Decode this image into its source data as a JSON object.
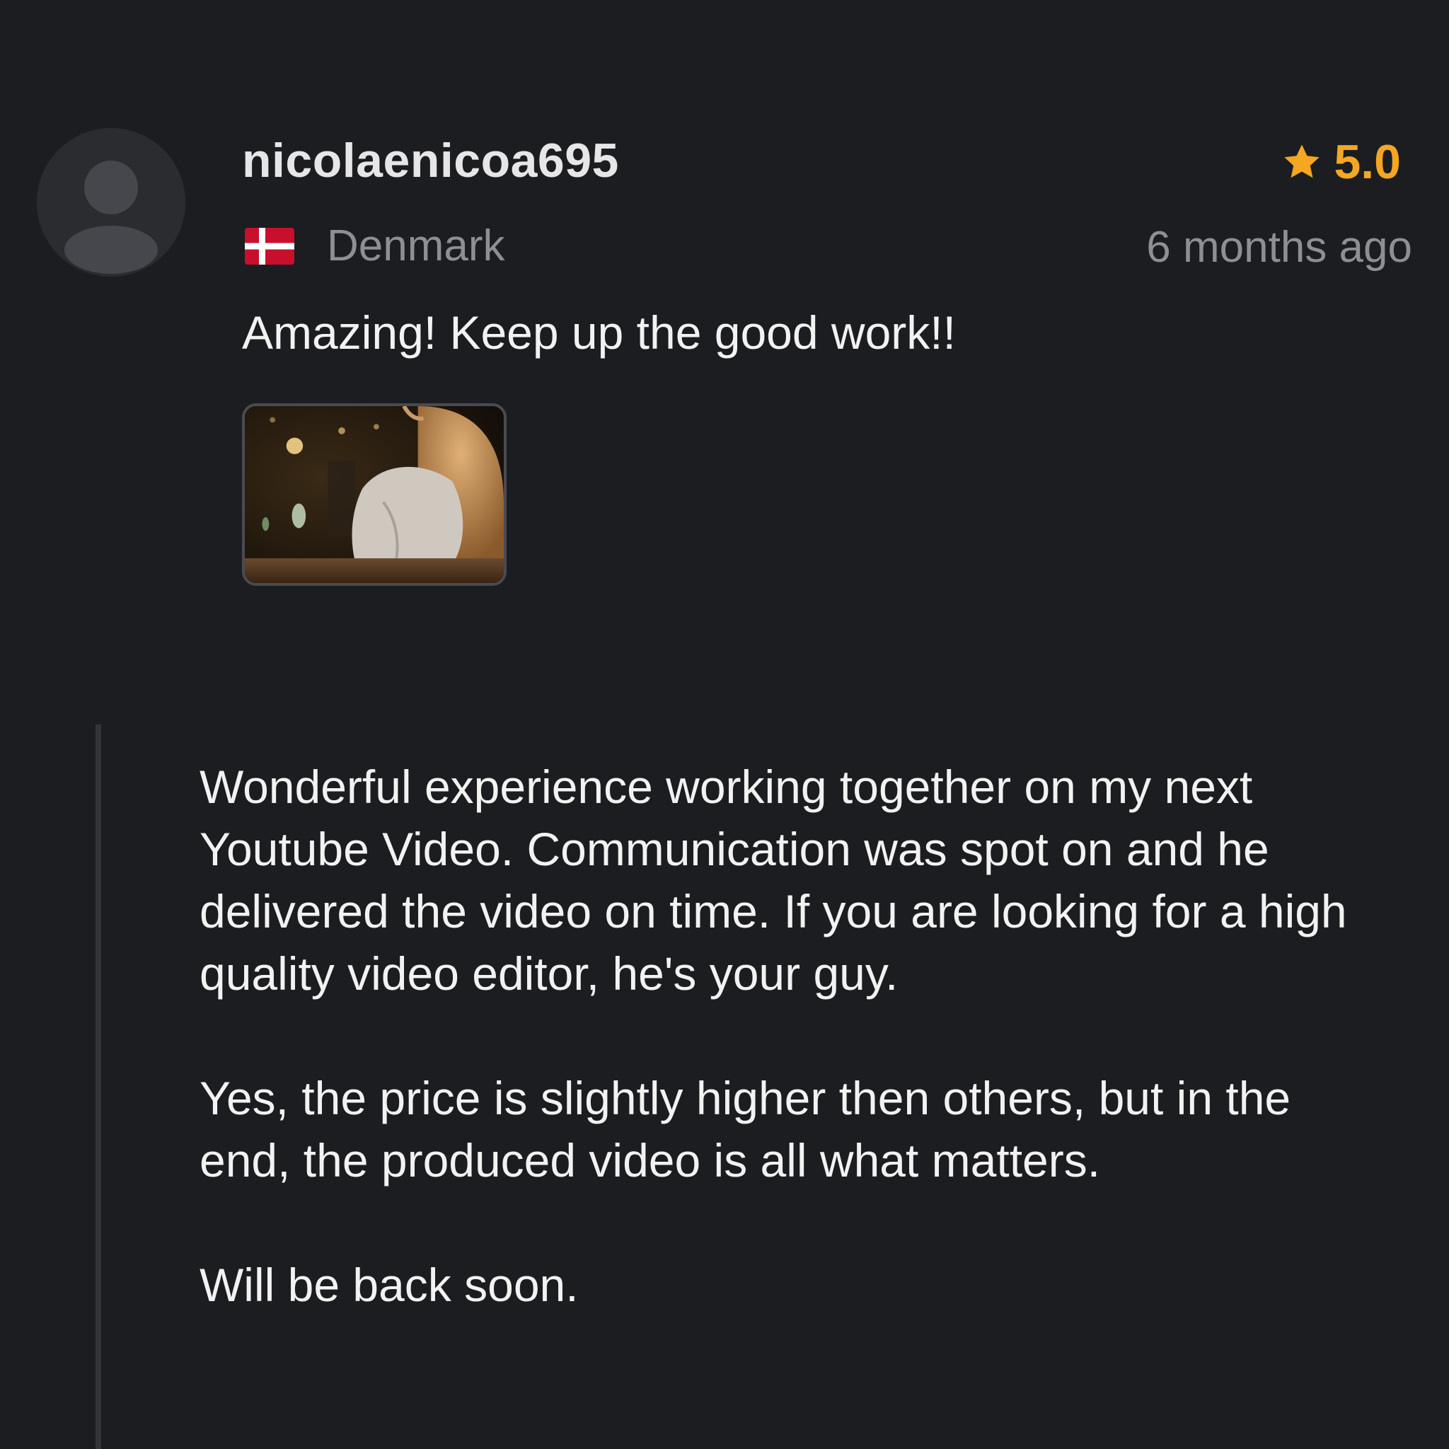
{
  "review": {
    "username": "nicolaenicoa695",
    "rating": "5.0",
    "country": "Denmark",
    "flag_icon": "denmark-flag-icon",
    "time_ago": "6 months ago",
    "title": "Amazing! Keep up the good work!!",
    "attachment_icon": "video-thumbnail",
    "colors": {
      "background": "#1c1d20",
      "rating_star": "#f5a623",
      "muted_text": "#8e8f95"
    }
  },
  "reply": {
    "paragraphs": [
      "Wonderful experience working together on my next Youtube Video. Communication was spot on and he delivered the video on time. If you are looking for a high quality video editor, he's your guy.",
      "Yes, the price is slightly higher then others, but in the end, the produced video is all what matters.",
      "Will be back soon."
    ]
  }
}
